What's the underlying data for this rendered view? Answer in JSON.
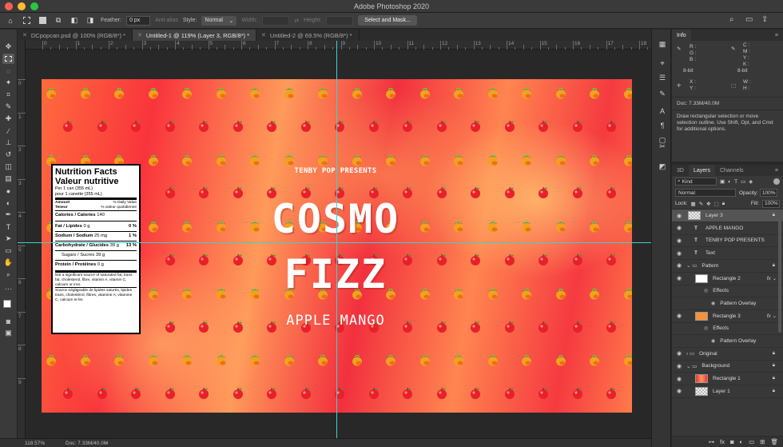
{
  "app": {
    "title": "Adobe Photoshop 2020"
  },
  "options_bar": {
    "feather_label": "Feather:",
    "feather_value": "0 px",
    "anti_alias_label": "Anti-alias",
    "style_label": "Style:",
    "style_value": "Normal",
    "width_label": "Width:",
    "height_label": "Height:",
    "select_mask_label": "Select and Mask..."
  },
  "tabs": [
    {
      "label": "DCpopcan.psd @ 100% (RGB/8*) *",
      "active": false
    },
    {
      "label": "Untitled-1 @ 119% (Layer 3, RGB/8*) *",
      "active": true
    },
    {
      "label": "Untitled-2 @ 69.5% (RGB/8*) *",
      "active": false
    }
  ],
  "ruler_top": [
    "0",
    "1",
    "2",
    "3",
    "4",
    "5",
    "6",
    "7",
    "8",
    "9",
    "10",
    "11",
    "12",
    "13",
    "14",
    "15",
    "16",
    "17",
    "18"
  ],
  "ruler_left": [
    "0",
    "1",
    "2",
    "3",
    "4",
    "5",
    "6",
    "7",
    "8",
    "9"
  ],
  "canvas": {
    "presenter": "TENBY POP PRESENTS",
    "title_line1": "COSMO",
    "title_line2": "FIZZ",
    "flavor": "APPLE MANGO"
  },
  "nutrition": {
    "title_en": "Nutrition Facts",
    "title_fr": "Valeur nutritive",
    "serving_en": "Per 1 can (355 mL)",
    "serving_fr": "pour 1 canette (355 mL)",
    "amount": "Amount",
    "teneur": "Teneur",
    "dv_en": "% Daily Value",
    "dv_fr": "% valeur quotidienne",
    "calories_label": "Calories / Calories",
    "calories_value": "140",
    "fat_label": "Fat / Lipides",
    "fat_amount": "0 g",
    "fat_dv": "0 %",
    "sodium_label": "Sodium / Sodium",
    "sodium_amount": "25 mg",
    "sodium_dv": "1 %",
    "carb_label": "Carbohydrate / Glucides",
    "carb_amount": "39 g",
    "carb_dv": "13 %",
    "sugars_label": "Sugars / Sucres",
    "sugars_amount": "39 g",
    "protein_label": "Protein / Protéines",
    "protein_amount": "0 g",
    "footnote_en": "Not a significant source of saturated fat, trans fat, cholesterol, fibre, vitamin A, vitamin C, calcium or iron.",
    "footnote_fr": "Source négligeable de lipides saturés, lipides trans, cholestérol, fibres, vitamine A, vitamine C, calcium et fer."
  },
  "status": {
    "zoom": "118.57%",
    "doc": "Doc: 7.33M/40.0M"
  },
  "info_panel": {
    "title": "Info",
    "r": "R :",
    "g": "G :",
    "b": "B :",
    "c": "C :",
    "m": "M :",
    "y": "Y :",
    "k": "K :",
    "bit1": "8-bit",
    "bit2": "8-bit",
    "x": "X :",
    "y2": "Y :",
    "w": "W :",
    "h": "H :",
    "doc": "Doc: 7.33M/40.0M",
    "hint": "Draw rectangular selection or move selection outline. Use Shift, Opt, and Cmd for additional options."
  },
  "layers_panel": {
    "tabs": [
      "3D",
      "Layers",
      "Channels"
    ],
    "kind": "Kind",
    "blend": "Normal",
    "opacity_label": "Opacity:",
    "opacity_value": "100%",
    "lock_label": "Lock:",
    "fill_label": "Fill:",
    "fill_value": "100%",
    "rows": [
      {
        "name": "Layer 3",
        "type": "pixel",
        "indent": 0,
        "selected": true
      },
      {
        "name": "APPLE MANGO",
        "type": "text",
        "indent": 0
      },
      {
        "name": "TENBY POP PRESENTS",
        "type": "text",
        "indent": 0
      },
      {
        "name": "Text",
        "type": "text",
        "indent": 0
      },
      {
        "name": "Pattern",
        "type": "group-open",
        "indent": 0
      },
      {
        "name": "Rectangle 2",
        "type": "shape",
        "indent": 1,
        "fx": true
      },
      {
        "name": "Effects",
        "type": "effects",
        "indent": 2
      },
      {
        "name": "Pattern Overlay",
        "type": "effect",
        "indent": 3
      },
      {
        "name": "Rectangle 3",
        "type": "shape-orange",
        "indent": 1,
        "fx": true
      },
      {
        "name": "Effects",
        "type": "effects",
        "indent": 2
      },
      {
        "name": "Pattern Overlay",
        "type": "effect",
        "indent": 3
      },
      {
        "name": "Original",
        "type": "group-closed",
        "indent": 0
      },
      {
        "name": "Background",
        "type": "group-open",
        "indent": 0
      },
      {
        "name": "Rectangle 1",
        "type": "gradient",
        "indent": 1
      },
      {
        "name": "Layer 1",
        "type": "pixel",
        "indent": 1
      }
    ]
  },
  "colors": {
    "accent": "#3fd0d0",
    "canvas_red": "#f2303e",
    "canvas_orange": "#ff9a5a"
  }
}
